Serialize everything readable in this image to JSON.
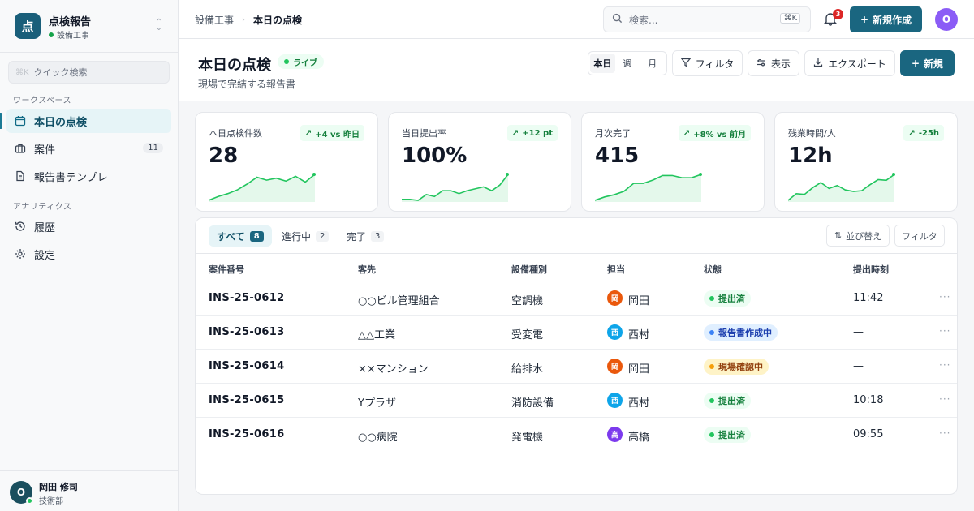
{
  "brand": {
    "logo_char": "点",
    "name": "点検報告",
    "workspace": "設備工事"
  },
  "sidebar": {
    "quick_search": {
      "kbd": "⌘K",
      "label": "クイック検索"
    },
    "section_workspace": "ワークスペース",
    "section_analytics": "アナリティクス",
    "items": [
      {
        "label": "本日の点検",
        "icon": "calendar-icon",
        "active": true
      },
      {
        "label": "案件",
        "icon": "briefcase-icon",
        "count": "11"
      },
      {
        "label": "報告書テンプレ",
        "icon": "document-icon"
      },
      {
        "label": "履歴",
        "icon": "history-icon"
      },
      {
        "label": "設定",
        "icon": "gear-icon"
      }
    ],
    "user": {
      "initial": "O",
      "name": "岡田 修司",
      "dept": "技術部"
    }
  },
  "topbar": {
    "breadcrumb": [
      "設備工事",
      "本日の点検"
    ],
    "search": {
      "placeholder": "検索...",
      "kbd": "⌘K"
    },
    "notifications": "3",
    "new_label": "新規作成",
    "avatar_initial": "O"
  },
  "page": {
    "title": "本日の点検",
    "live_label": "ライブ",
    "subtitle": "現場で完結する報告書",
    "period": {
      "options": [
        "本日",
        "週",
        "月"
      ],
      "selected": "本日"
    },
    "filter_label": "フィルタ",
    "view_label": "表示",
    "export_label": "エクスポート",
    "new_label": "新規"
  },
  "kpis": [
    {
      "label": "本日点検件数",
      "value": "28",
      "delta": "+4 vs 昨日",
      "trend": [
        2,
        6,
        9,
        13,
        19,
        26,
        23,
        25,
        22,
        27,
        21,
        29
      ]
    },
    {
      "label": "当日提出率",
      "value": "100%",
      "delta": "+12 pt",
      "trend": [
        3,
        3,
        2,
        8,
        6,
        12,
        12,
        9,
        12,
        14,
        16,
        12,
        18,
        29
      ]
    },
    {
      "label": "月次完了",
      "value": "415",
      "delta": "+8% vs 前月",
      "trend": [
        2,
        5,
        7,
        10,
        17,
        17,
        20,
        24,
        24,
        22,
        22,
        25
      ]
    },
    {
      "label": "残業時間/人",
      "value": "12h",
      "delta": "-25h",
      "trend": [
        2,
        11,
        10,
        19,
        26,
        18,
        22,
        16,
        14,
        15,
        23,
        30,
        29,
        37
      ]
    }
  ],
  "colors": {
    "accent": "#1a6680",
    "spark": "#22c55e",
    "success": "#15803d"
  },
  "table": {
    "tabs": [
      {
        "label": "すべて",
        "count": "8",
        "active": true
      },
      {
        "label": "進行中",
        "count": "2"
      },
      {
        "label": "完了",
        "count": "3"
      }
    ],
    "sort_label": "並び替え",
    "filter_label": "フィルタ",
    "columns": [
      "案件番号",
      "客先",
      "設備種別",
      "担当",
      "状態",
      "提出時刻"
    ],
    "rows": [
      {
        "id": "INS-25-0612",
        "client": "○○ビル管理組合",
        "equipment": "空調機",
        "assignee": "岡田",
        "avatar": "岡",
        "avatar_color": "#ea580c",
        "status": "提出済",
        "status_kind": "done",
        "time": "11:42"
      },
      {
        "id": "INS-25-0613",
        "client": "△△工業",
        "equipment": "受変電",
        "assignee": "西村",
        "avatar": "西",
        "avatar_color": "#0ea5e9",
        "status": "報告書作成中",
        "status_kind": "progress",
        "time": "—"
      },
      {
        "id": "INS-25-0614",
        "client": "××マンション",
        "equipment": "給排水",
        "assignee": "岡田",
        "avatar": "岡",
        "avatar_color": "#ea580c",
        "status": "現場確認中",
        "status_kind": "onsite",
        "time": "—"
      },
      {
        "id": "INS-25-0615",
        "client": "Yプラザ",
        "equipment": "消防設備",
        "assignee": "西村",
        "avatar": "西",
        "avatar_color": "#0ea5e9",
        "status": "提出済",
        "status_kind": "done",
        "time": "10:18"
      },
      {
        "id": "INS-25-0616",
        "client": "○○病院",
        "equipment": "発電機",
        "assignee": "高橋",
        "avatar": "高",
        "avatar_color": "#7c3aed",
        "status": "提出済",
        "status_kind": "done",
        "time": "09:55"
      }
    ]
  }
}
